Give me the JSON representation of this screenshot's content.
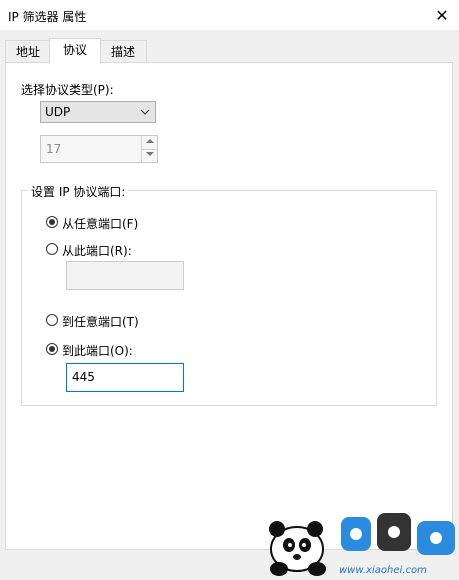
{
  "window": {
    "title": "IP 筛选器 属性",
    "close_glyph": "✕"
  },
  "tabs": [
    {
      "label": "地址",
      "active": false
    },
    {
      "label": "协议",
      "active": true
    },
    {
      "label": "描述",
      "active": false
    }
  ],
  "protocol": {
    "type_label": "选择协议类型(P):",
    "selected": "UDP",
    "number": "17"
  },
  "port_group": {
    "title": "设置 IP 协议端口:",
    "from_any": {
      "label": "从任意端口(F)",
      "checked": true
    },
    "from_this": {
      "label": "从此端口(R):",
      "checked": false,
      "value": ""
    },
    "to_any": {
      "label": "到任意端口(T)",
      "checked": false
    },
    "to_this": {
      "label": "到此端口(O):",
      "checked": true,
      "value": "445"
    }
  },
  "watermark": {
    "text": "www.xiaohei.com"
  },
  "colors": {
    "focus_border": "#0078d7",
    "watermark_blue": "#1e73c8"
  }
}
